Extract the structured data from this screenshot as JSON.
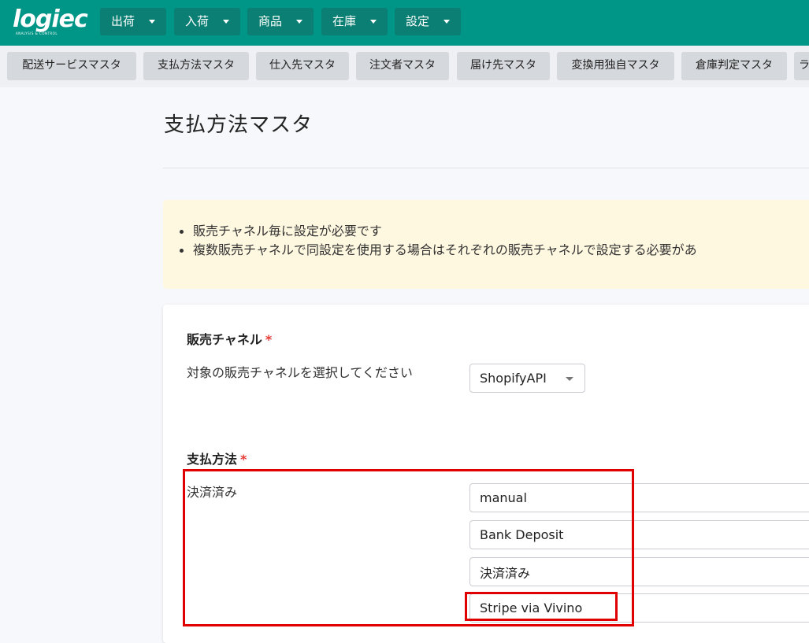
{
  "logo": {
    "text": "logiec",
    "sub": "ANALYSIS & CONTROL"
  },
  "nav": {
    "items": [
      {
        "label": "出荷"
      },
      {
        "label": "入荷"
      },
      {
        "label": "商品"
      },
      {
        "label": "在庫"
      },
      {
        "label": "設定"
      }
    ]
  },
  "subnav": {
    "items": [
      {
        "label": "配送サービスマスタ"
      },
      {
        "label": "支払方法マスタ"
      },
      {
        "label": "仕入先マスタ"
      },
      {
        "label": "注文者マスタ"
      },
      {
        "label": "届け先マスタ"
      },
      {
        "label": "変換用独自マスタ"
      },
      {
        "label": "倉庫判定マスタ"
      },
      {
        "label": "ラ"
      }
    ]
  },
  "page": {
    "title": "支払方法マスタ"
  },
  "notice": {
    "items": [
      "販売チャネル毎に設定が必要です",
      "複数販売チャネルで同設定を使用する場合はそれぞれの販売チャネルで設定する必要があ"
    ]
  },
  "form": {
    "channel_section": "販売チャネル",
    "required_mark": "*",
    "channel_label": "対象の販売チャネルを選択してください",
    "channel_value": "ShopifyAPI",
    "payment_section": "支払方法",
    "settled_label": "決済済み",
    "payment_inputs": [
      {
        "value": "manual"
      },
      {
        "value": "Bank Deposit"
      },
      {
        "value": "決済済み"
      },
      {
        "value": "Stripe via Vivino"
      }
    ]
  },
  "colors": {
    "brand": "#009687",
    "highlight": "#e00000",
    "required": "#e53935"
  }
}
